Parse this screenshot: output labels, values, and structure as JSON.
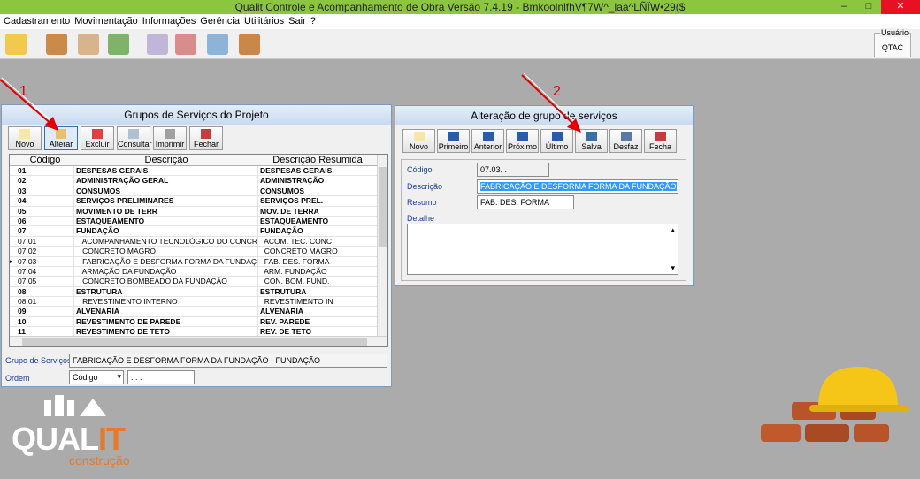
{
  "window": {
    "title": "Qualit Controle e Acompanhamento de Obra Versão 7.4.19 - BmkoolnlfhV¶7W^_laa^LÑÏW•29($",
    "min": "–",
    "max": "□",
    "close": "✕"
  },
  "menu": [
    "Cadastramento",
    "Movimentação",
    "Informações",
    "Gerência",
    "Utilitários",
    "Sair",
    "?"
  ],
  "user": {
    "label": "Usuário",
    "value": "QTAC"
  },
  "left_panel": {
    "title": "Grupos de Serviços do Projeto",
    "buttons": [
      "Novo",
      "Alterar",
      "Excluir",
      "Consultar",
      "Imprimir",
      "Fechar"
    ],
    "columns": [
      "Código",
      "Descrição",
      "Descrição Resumida"
    ],
    "rows": [
      {
        "code": "01",
        "desc": "DESPESAS GERAIS",
        "short": "DESPESAS GERAIS",
        "bold": true
      },
      {
        "code": "02",
        "desc": "ADMINISTRAÇÃO GERAL",
        "short": "ADMINISTRAÇÃO",
        "bold": true
      },
      {
        "code": "03",
        "desc": "CONSUMOS",
        "short": "CONSUMOS",
        "bold": true
      },
      {
        "code": "04",
        "desc": "SERVIÇOS PRELIMINARES",
        "short": "SERVIÇOS PREL.",
        "bold": true
      },
      {
        "code": "05",
        "desc": "MOVIMENTO DE TERR",
        "short": "MOV. DE TERRA",
        "bold": true
      },
      {
        "code": "06",
        "desc": "ESTAQUEAMENTO",
        "short": "ESTAQUEAMENTO",
        "bold": true
      },
      {
        "code": "07",
        "desc": "FUNDAÇÃO",
        "short": "FUNDAÇÃO",
        "bold": true
      },
      {
        "code": "07.01",
        "desc": "   ACOMPANHAMENTO TECNOLÓGICO DO CONCRETO",
        "short": "  ACOM. TEC. CONC",
        "bold": false
      },
      {
        "code": "07.02",
        "desc": "   CONCRETO MAGRO",
        "short": "  CONCRETO MAGRO",
        "bold": false
      },
      {
        "code": "07.03",
        "desc": "   FABRICAÇÃO E DESFORMA FORMA DA FUNDAÇÃO",
        "short": "  FAB. DES. FORMA",
        "bold": false,
        "current": true
      },
      {
        "code": "07.04",
        "desc": "   ARMAÇÃO DA FUNDAÇÃO",
        "short": "  ARM. FUNDAÇÃO",
        "bold": false
      },
      {
        "code": "07.05",
        "desc": "   CONCRETO BOMBEADO DA FUNDAÇÃO",
        "short": "  CON. BOM. FUND.",
        "bold": false
      },
      {
        "code": "08",
        "desc": "ESTRUTURA",
        "short": "ESTRUTURA",
        "bold": true
      },
      {
        "code": "08.01",
        "desc": "   REVESTIMENTO INTERNO",
        "short": "  REVESTIMENTO IN",
        "bold": false
      },
      {
        "code": "09",
        "desc": "ALVENARIA",
        "short": "ALVENARIA",
        "bold": true
      },
      {
        "code": "10",
        "desc": "REVESTIMENTO DE PAREDE",
        "short": "REV. PAREDE",
        "bold": true
      },
      {
        "code": "11",
        "desc": "REVESTIMENTO DE TETO",
        "short": "REV. DE TETO",
        "bold": true
      }
    ],
    "group_label": "Grupo de Serviços",
    "group_value": "FABRICAÇÃO E DESFORMA FORMA DA FUNDAÇÃO - FUNDAÇÃO",
    "order_label": "Ordem",
    "order_value": "Código",
    "order_extra": ". . ."
  },
  "right_panel": {
    "title": "Alteração de grupo de serviços",
    "buttons": [
      "Novo",
      "Primeiro",
      "Anterior",
      "Próximo",
      "Último",
      "Salva",
      "Desfaz",
      "Fecha"
    ],
    "code_label": "Código",
    "code_value": "07.03.  .",
    "desc_label": "Descrição",
    "desc_value": "FABRICAÇÃO E DESFORMA FORMA DA FUNDAÇÃO",
    "resumo_label": "Resumo",
    "resumo_value": "FAB. DES. FORMA",
    "detail_label": "Detalhe"
  },
  "annotations": [
    "1",
    "2"
  ],
  "logo": {
    "main": "QUAL",
    "accent": "IT",
    "sub": "construção"
  },
  "colors": {
    "titlebar": "#8cc63f",
    "selection": "#3399ff",
    "annotation": "#e00000",
    "brand_orange": "#e67a2a"
  }
}
